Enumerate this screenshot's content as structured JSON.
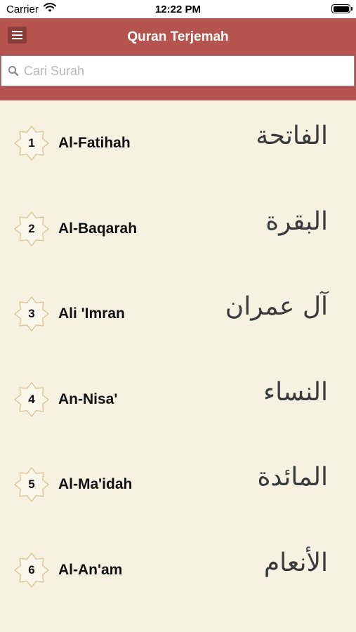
{
  "status_bar": {
    "carrier": "Carrier",
    "time": "12:22 PM"
  },
  "nav": {
    "title": "Quran Terjemah",
    "menu_icon": "hamburger-menu-icon"
  },
  "search": {
    "placeholder": "Cari Surah",
    "value": "",
    "icon": "search-icon"
  },
  "colors": {
    "header": "#b5544f",
    "background": "#f7f1e1",
    "menu_button": "#8c3d3a"
  },
  "surahs": [
    {
      "number": "1",
      "name": "Al-Fatihah",
      "arabic": "الفاتحة"
    },
    {
      "number": "2",
      "name": "Al-Baqarah",
      "arabic": "البقرة"
    },
    {
      "number": "3",
      "name": "Ali 'Imran",
      "arabic": "آل عمران"
    },
    {
      "number": "4",
      "name": "An-Nisa'",
      "arabic": "النساء"
    },
    {
      "number": "5",
      "name": "Al-Ma'idah",
      "arabic": "المائدة"
    },
    {
      "number": "6",
      "name": "Al-An'am",
      "arabic": "الأنعام"
    }
  ]
}
